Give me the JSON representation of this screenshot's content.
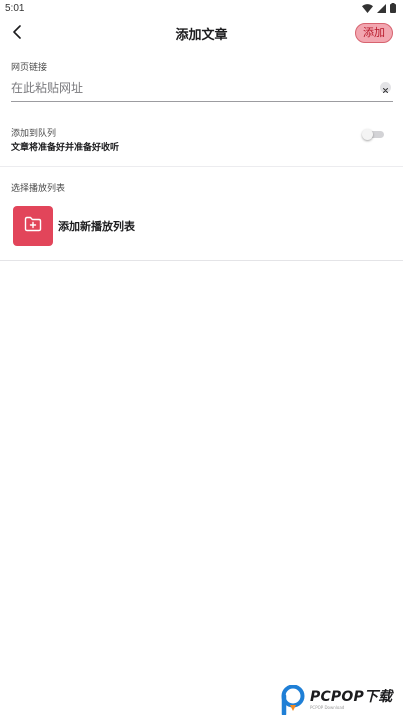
{
  "status_bar": {
    "time": "5:01"
  },
  "app_bar": {
    "title": "添加文章",
    "add_label": "添加"
  },
  "url": {
    "label": "网页链接",
    "placeholder": "在此粘贴网址",
    "value": ""
  },
  "queue": {
    "title": "添加到队列",
    "description": "文章将准备好并准备好收听",
    "enabled": false
  },
  "playlist": {
    "section_label": "选择播放列表",
    "new_label": "添加新播放列表"
  },
  "watermark": {
    "brand": "PCPOP下载",
    "subtext": "PCPOP Download"
  },
  "colors": {
    "accent": "#e2455a",
    "add_button_bg": "#f2a6b0",
    "add_button_text": "#b7182a",
    "toggle_off": "#d3d3d6"
  },
  "icons": {
    "back": "chevron-left-icon",
    "clear": "close-icon",
    "folder": "folder-plus-icon",
    "wifi": "wifi-icon",
    "signal": "signal-icon",
    "battery": "battery-icon"
  }
}
